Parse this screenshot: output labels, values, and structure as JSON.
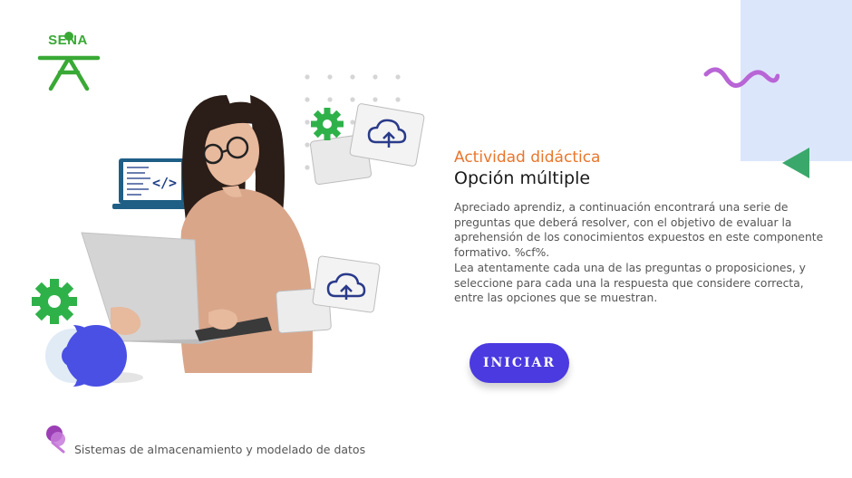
{
  "brand": {
    "logo_text": "SENA"
  },
  "heading": {
    "subtitle": "Actividad didáctica",
    "title": "Opción múltiple"
  },
  "instructions": {
    "paragraph1": "Apreciado aprendiz, a continuación encontrará una serie de preguntas que deberá resolver, con el objetivo de evaluar la aprehensión de los conocimientos expuestos en este componente formativo. %cf%.",
    "paragraph2": "Lea atentamente cada una de las preguntas o proposiciones, y seleccione para cada una la respuesta que considere correcta, entre las opciones que se muestran."
  },
  "actions": {
    "start_label": "INICIAR"
  },
  "footer": {
    "course_name": "Sistemas de almacenamiento y modelado de datos"
  },
  "colors": {
    "accent_orange": "#e9762b",
    "button": "#4a3ae0",
    "sena_green": "#39a935",
    "wave": "#b865d6",
    "panel_blue": "#dce6fb",
    "triangle": "#3aa86b"
  },
  "icons": [
    "sena-logo",
    "wave-decoration",
    "triangle-decoration",
    "laptop-code-icon",
    "gear-icon",
    "cloud-upload-folder-icon",
    "location-pin-icon"
  ]
}
